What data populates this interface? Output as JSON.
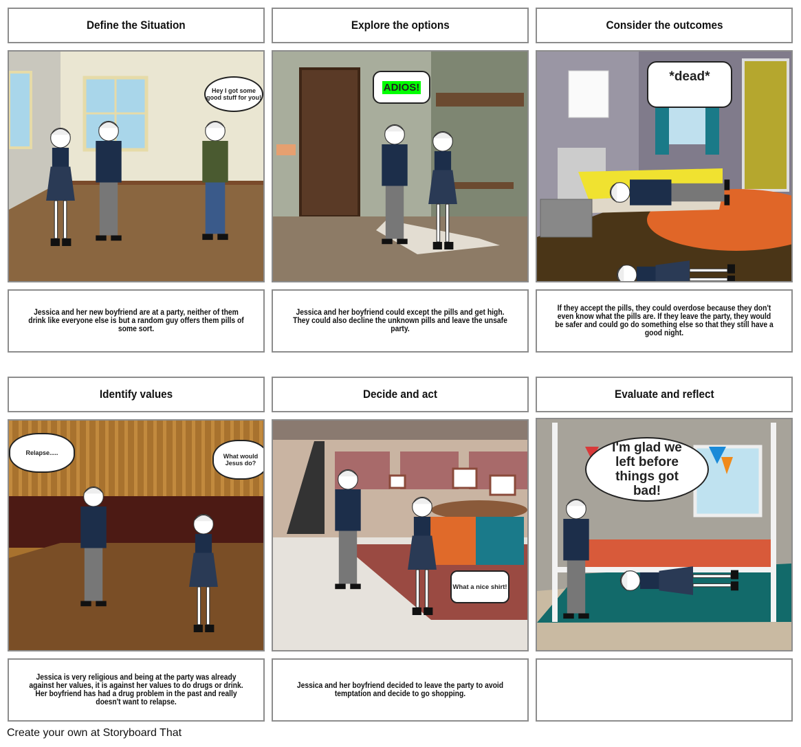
{
  "panels": [
    {
      "title": "Define the Situation",
      "caption": "Jessica and her new boyfriend are at a party, neither of them drink like everyone else is but a random guy offers them pills of some sort.",
      "bubbles": [
        "Hey I got some good stuff for you!"
      ]
    },
    {
      "title": "Explore the options",
      "caption": "Jessica and her boyfriend could except the pills and get high. They could also decline the unknown pills and leave the unsafe party.",
      "bubbles": [
        "ADIOS!"
      ]
    },
    {
      "title": "Consider the outcomes",
      "caption": "If they accept the pills, they could overdose because they don't even know what the pills are. If they leave the party, they would be safer and could go do something else so that they still have a good night.",
      "bubbles": [
        "*dead*"
      ]
    },
    {
      "title": "Identify values",
      "caption": "Jessica is very religious and being at the party was already against her values, it is against her values to do drugs or drink. Her boyfriend has had a drug problem in the past and really doesn't want to relapse.",
      "bubbles": [
        "Relapse.....",
        "What would Jesus do?"
      ]
    },
    {
      "title": "Decide and act",
      "caption": "Jessica and her boyfriend decided to leave the party to avoid temptation and decide to go shopping.",
      "bubbles": [
        "What a nice shirt!"
      ]
    },
    {
      "title": "Evaluate and reflect",
      "caption": "",
      "bubbles": [
        "I'm glad we left before things got bad!"
      ]
    }
  ],
  "footer": "Create your own at Storyboard That",
  "colors": {
    "border": "#8c8c8c",
    "adios_highlight": "#00ff00",
    "shirt": "#1c2e4a"
  }
}
